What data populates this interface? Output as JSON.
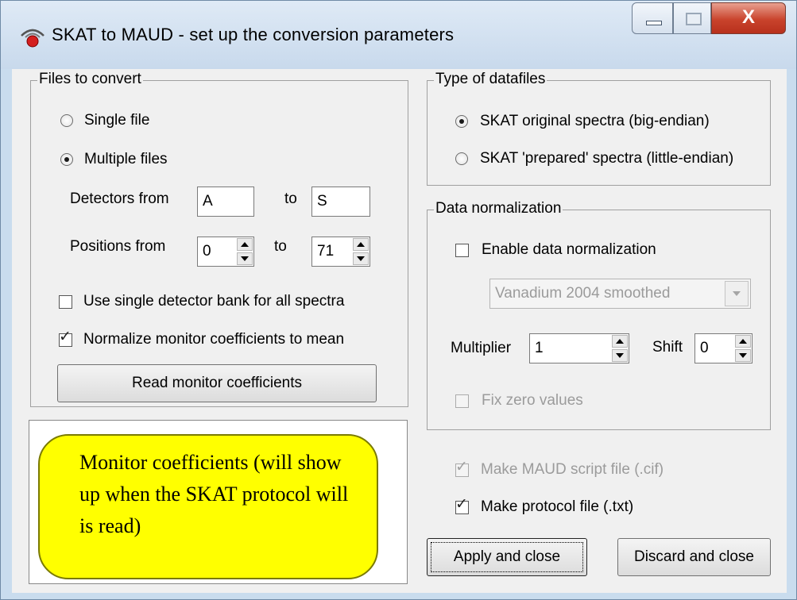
{
  "window": {
    "title": "SKAT to MAUD - set up the conversion parameters",
    "close_glyph": "X"
  },
  "files_group": {
    "legend": "Files to convert",
    "single_file": {
      "label": "Single file",
      "selected": false
    },
    "multiple_files": {
      "label": "Multiple files",
      "selected": true
    },
    "detectors_label": "Detectors from",
    "detectors_from": "A",
    "to_label": "to",
    "detectors_to": "S",
    "positions_label": "Positions from",
    "positions_from": "0",
    "positions_to": "71",
    "single_bank": {
      "label": "Use single detector bank for all spectra",
      "checked": false
    },
    "normalize": {
      "label": "Normalize monitor coefficients to mean",
      "checked": true
    },
    "read_button": "Read monitor coefficients"
  },
  "memo": {
    "callout": "Monitor coefficients (will show up when the SKAT protocol will is read)"
  },
  "datafiles_group": {
    "legend": "Type of datafiles",
    "original": {
      "label": "SKAT original spectra (big-endian)",
      "selected": true
    },
    "prepared": {
      "label": "SKAT 'prepared' spectra (little-endian)",
      "selected": false
    }
  },
  "normalization_group": {
    "legend": "Data normalization",
    "enable": {
      "label": "Enable data normalization",
      "checked": false
    },
    "dataset": "Vanadium 2004 smoothed",
    "multiplier_label": "Multiplier",
    "multiplier": "1",
    "shift_label": "Shift",
    "shift": "0",
    "fix_zero": {
      "label": "Fix zero values",
      "checked": false
    }
  },
  "outputs": {
    "maud_script": {
      "label": "Make MAUD script file (.cif)",
      "checked": true
    },
    "protocol": {
      "label": "Make protocol file (.txt)",
      "checked": true
    }
  },
  "buttons": {
    "apply": "Apply and close",
    "discard": "Discard and close"
  },
  "colors": {
    "callout_fill": "#ffff00",
    "close_button": "#c9432c",
    "dialog_bg": "#f0f0f0"
  }
}
